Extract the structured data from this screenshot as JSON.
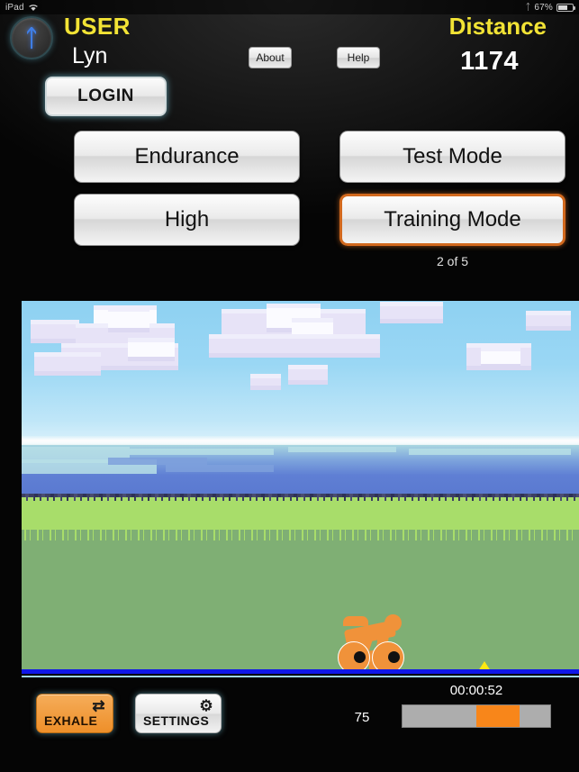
{
  "statusbar": {
    "device": "iPad",
    "wifi_icon": "wifi-icon",
    "bluetooth_icon": "bluetooth-icon",
    "battery_percent": "67%",
    "battery_icon": "battery-icon"
  },
  "header": {
    "bluetooth_button_icon": "bluetooth-icon",
    "user_label": "USER",
    "user_name": "Lyn",
    "login_label": "LOGIN",
    "about_label": "About",
    "help_label": "Help",
    "distance_label": "Distance",
    "distance_value": "1174"
  },
  "modes": {
    "endurance_label": "Endurance",
    "high_label": "High",
    "test_mode_label": "Test Mode",
    "training_mode_label": "Training Mode",
    "page_count": "2 of 5",
    "selected": "Training Mode",
    "selected_border_color": "#d2691e"
  },
  "scene": {
    "sky_color": "#9ad7f4",
    "water_color": "#5f7fd4",
    "field_color": "#7faf74",
    "bush_color": "#a8dd6a",
    "road_color": "#0f17e8",
    "rider_color": "#f0923a",
    "marker_color": "#ffe812",
    "rider_name": "cyclist-avatar",
    "marker_name": "goal-marker"
  },
  "footer": {
    "exhale_label": "EXHALE",
    "exhale_icon": "shuffle-icon",
    "exhale_color": "#ee8f29",
    "settings_label": "SETTINGS",
    "settings_icon": "gear-icon",
    "timer": "00:00:52",
    "rep_count": "75",
    "progress": {
      "segments": [
        {
          "name": "elapsed",
          "width_pct": 50,
          "color": "#adadad"
        },
        {
          "name": "active",
          "width_pct": 29,
          "color": "#f8861a"
        },
        {
          "name": "remaining",
          "width_pct": 21,
          "color": "#adadad"
        }
      ]
    }
  }
}
